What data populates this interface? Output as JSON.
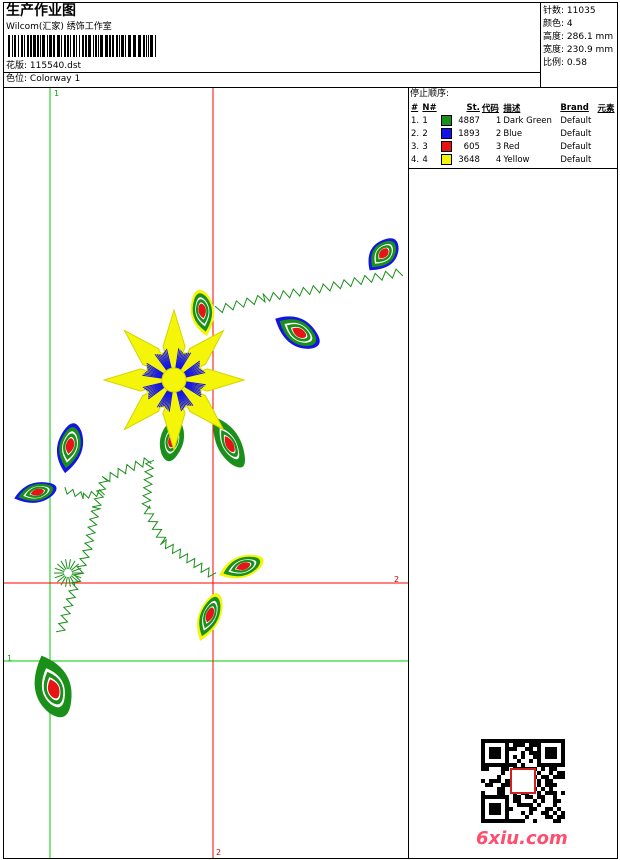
{
  "header": {
    "title": "生产作业图",
    "studio": "Wilcom(汇家) 绣饰工作室",
    "design_label": "花版:",
    "design_value": "115540.dst",
    "color_label": "色位:",
    "color_value": "Colorway 1"
  },
  "stats": [
    {
      "label": "针数:",
      "value": "11035"
    },
    {
      "label": "颜色:",
      "value": "4"
    },
    {
      "label": "高度:",
      "value": "286.1 mm"
    },
    {
      "label": "宽度:",
      "value": "230.9 mm"
    },
    {
      "label": "比例:",
      "value": "0.58"
    }
  ],
  "stoplist": {
    "title": "停止顺序:",
    "headers": [
      "#",
      "N#",
      "St.",
      "代码",
      "描述",
      "Brand",
      "元素"
    ],
    "rows": [
      {
        "num": "1.",
        "n": "1",
        "color": "#1a8f1a",
        "stitches": "4887",
        "code": "1",
        "desc": "Dark Green",
        "brand": "Default"
      },
      {
        "num": "2.",
        "n": "2",
        "color": "#1414e6",
        "stitches": "1893",
        "code": "2",
        "desc": "Blue",
        "brand": "Default"
      },
      {
        "num": "3.",
        "n": "3",
        "color": "#e61414",
        "stitches": "605",
        "code": "3",
        "desc": "Red",
        "brand": "Default"
      },
      {
        "num": "4.",
        "n": "4",
        "color": "#f5f50a",
        "stitches": "3648",
        "code": "4",
        "desc": "Yellow",
        "brand": "Default"
      }
    ]
  },
  "guides": {
    "v1": "1",
    "v2": "2",
    "h1": "1",
    "h2": "2"
  },
  "colors": {
    "green_guide": "#00cc00",
    "red_guide": "#ff0000"
  },
  "watermark": "6xiu.com",
  "icons": [
    "barcode-icon",
    "qr-code-icon",
    "seal-icon"
  ]
}
